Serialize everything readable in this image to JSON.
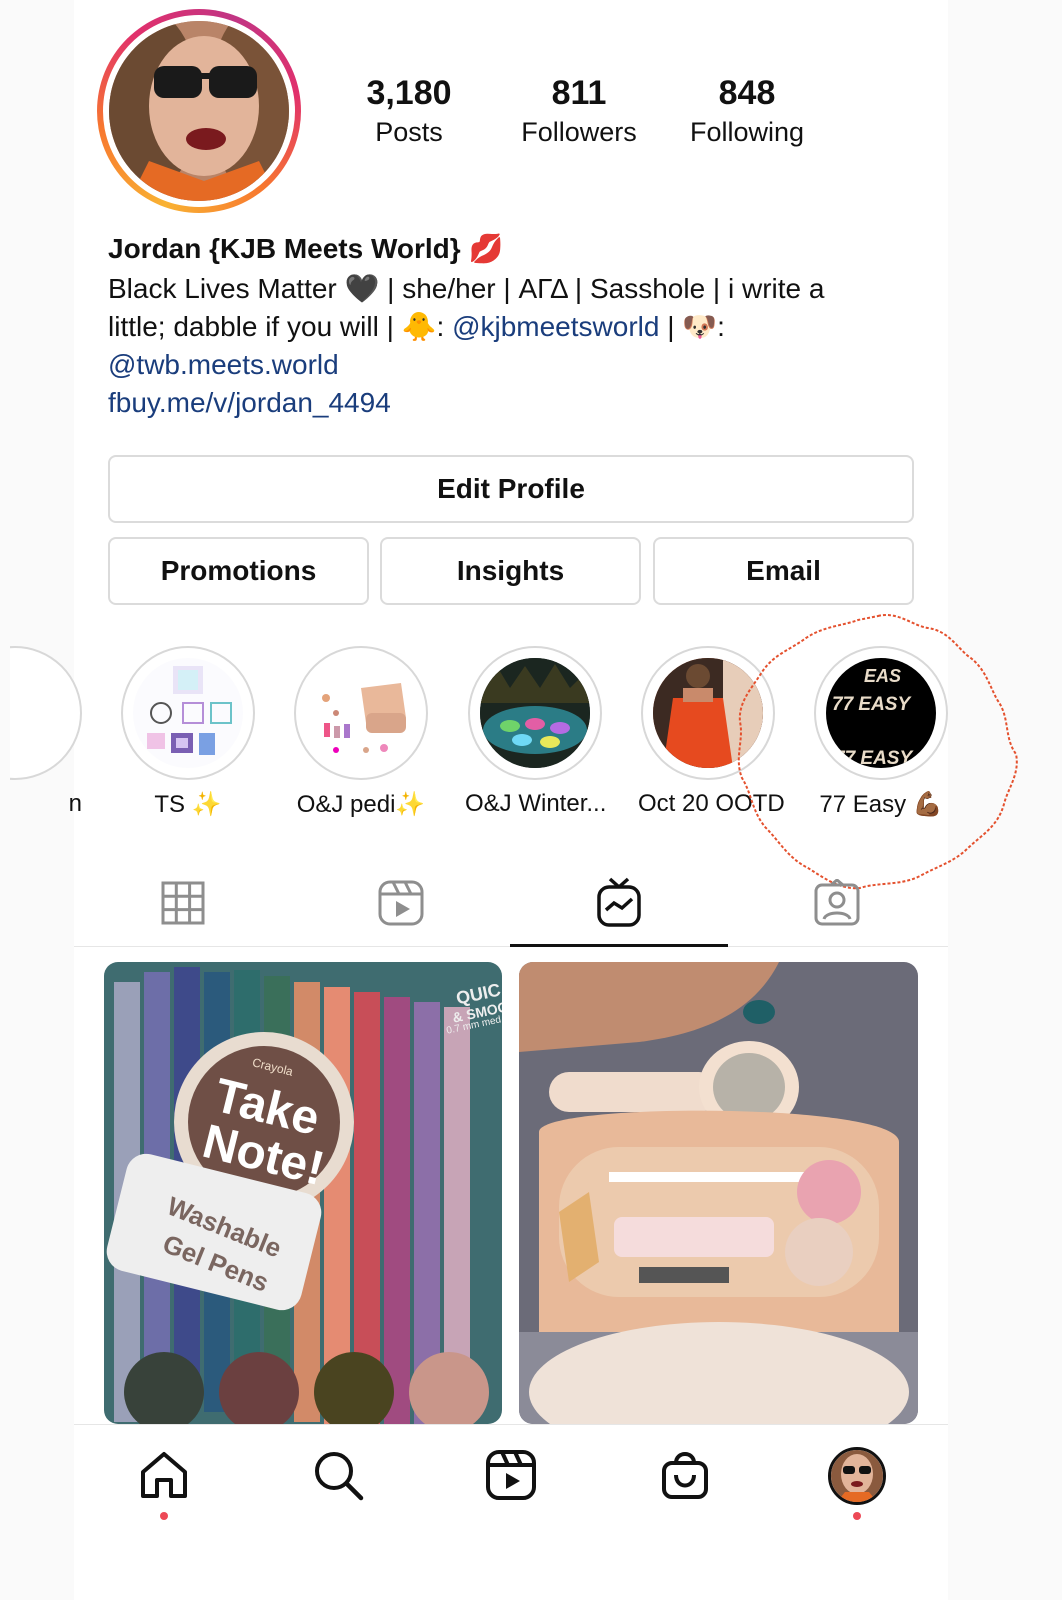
{
  "profile": {
    "stats": [
      {
        "value": "3,180",
        "label": "Posts"
      },
      {
        "value": "811",
        "label": "Followers"
      },
      {
        "value": "848",
        "label": "Following"
      }
    ],
    "name": "Jordan {KJB Meets World}",
    "name_emoji": "💋",
    "bio_line1": "Black Lives Matter 🖤 | she/her | ΑΓΔ | Sasshole | i write a",
    "bio_line2_prefix": "little; dabble if you will | 🐥: ",
    "bio_handle1": "@kjbmeetsworld",
    "bio_line2_suffix": " | 🐶:",
    "bio_handle2": "@twb.meets.world",
    "bio_link": "fbuy.me/v/jordan_4494"
  },
  "buttons": {
    "edit_profile": "Edit Profile",
    "promotions": "Promotions",
    "insights": "Insights",
    "email": "Email"
  },
  "highlights": [
    {
      "label": "n"
    },
    {
      "label": "TS ✨"
    },
    {
      "label": "O&J pedi✨"
    },
    {
      "label": "O&J Winter..."
    },
    {
      "label": "Oct 20 OOTD"
    },
    {
      "label": "77 Easy 💪🏾"
    }
  ],
  "highlight_77_text": [
    "EAS",
    "77 EASY",
    "77 EASY"
  ],
  "posts": {
    "post1_texts": [
      "QUIC",
      "& SMOO",
      "0.7 mm med",
      "Crayola",
      "Take",
      "Note!",
      "Washable",
      "Gel Pens"
    ]
  },
  "colors": {
    "accent_link": "#1a3d7c",
    "annotation": "#e4512e",
    "notification_dot": "#ed4956"
  },
  "tabs": [
    "grid-icon",
    "reels-icon",
    "igtv-icon",
    "tagged-icon"
  ],
  "nav": [
    "home-icon",
    "search-icon",
    "reels-icon",
    "shop-icon",
    "profile-avatar"
  ]
}
